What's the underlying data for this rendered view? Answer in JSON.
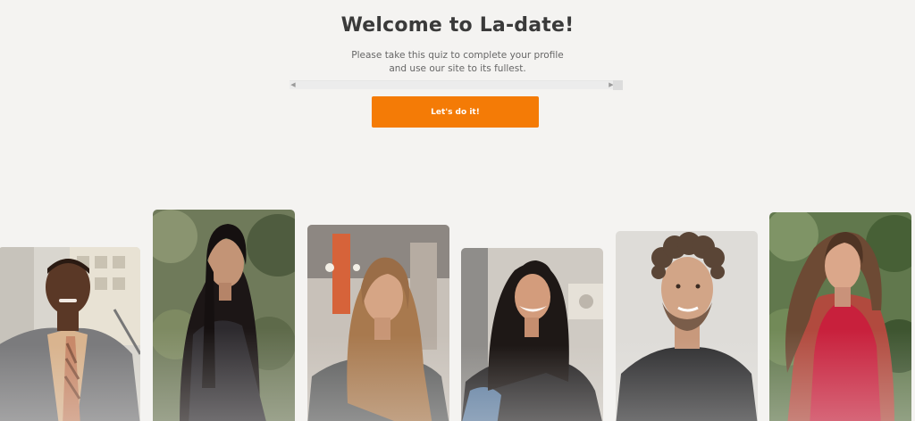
{
  "hero": {
    "title": "Welcome to La-date!",
    "subtitle_line1": "Please take this quiz to complete your profile",
    "subtitle_line2": "and use our site to its fullest.",
    "cta_label": "Let's do it!"
  },
  "colors": {
    "accent": "#f47b06",
    "background": "#f4f3f1"
  },
  "scrollbar": {
    "left_arrow_icon": "arrow-left-icon",
    "right_arrow_icon": "arrow-right-icon"
  },
  "photos": [
    {
      "id": "man-suit"
    },
    {
      "id": "woman-dark-hair"
    },
    {
      "id": "woman-grey-top"
    },
    {
      "id": "woman-smiling"
    },
    {
      "id": "man-curly-hair"
    },
    {
      "id": "woman-red-top"
    }
  ]
}
